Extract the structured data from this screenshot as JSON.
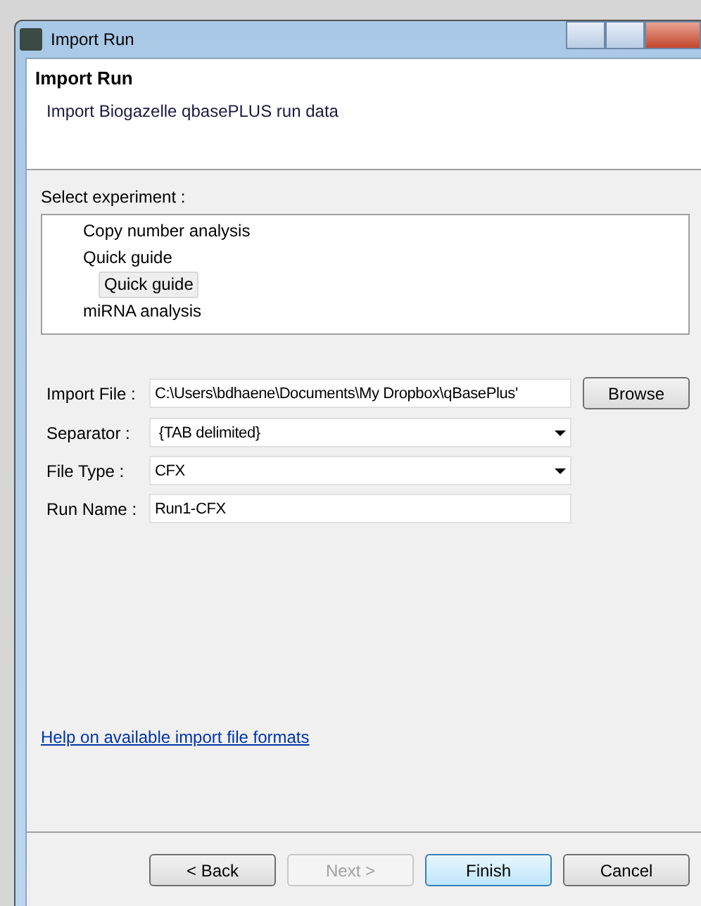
{
  "window": {
    "title": "Import Run"
  },
  "header": {
    "title": "Import Run",
    "subtitle": "Import Biogazelle qbasePLUS run data"
  },
  "experiment": {
    "label": "Select experiment :",
    "tree": [
      {
        "label": "Copy number analysis",
        "selected": false
      },
      {
        "label": "Quick guide",
        "selected": false,
        "children": [
          {
            "label": "Quick guide",
            "selected": true
          }
        ]
      },
      {
        "label": "miRNA analysis",
        "selected": false
      }
    ]
  },
  "form": [
    {
      "kind": "text",
      "label": "Import File :",
      "value": "C:\\Users\\bdhaene\\Documents\\My Dropbox\\qBasePlus'",
      "button": "Browse"
    },
    {
      "kind": "dropdown",
      "label": "Separator :",
      "value": " {TAB delimited}"
    },
    {
      "kind": "dropdown",
      "label": "File Type :",
      "value": "CFX"
    },
    {
      "kind": "text",
      "label": "Run Name :",
      "value": "Run1-CFX"
    }
  ],
  "help_link": "Help on available import file formats",
  "buttons": [
    {
      "label": "< Back",
      "disabled": false,
      "default": false
    },
    {
      "label": "Next >",
      "disabled": true,
      "default": false
    },
    {
      "label": "Finish",
      "disabled": false,
      "default": true
    },
    {
      "label": "Cancel",
      "disabled": false,
      "default": false
    }
  ]
}
